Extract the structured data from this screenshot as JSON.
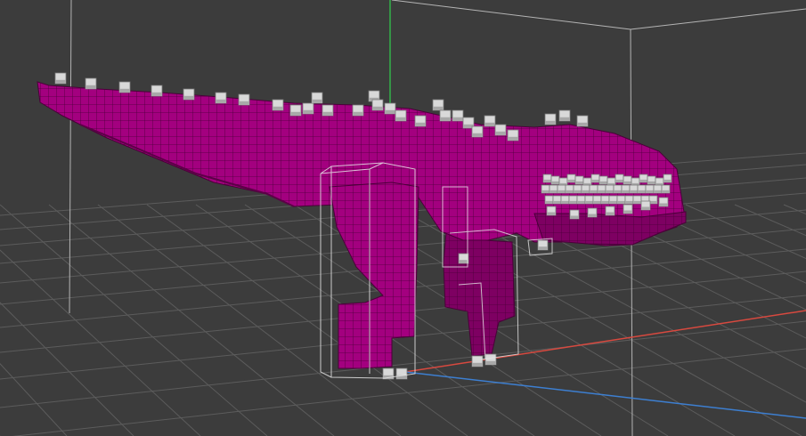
{
  "viewport": {
    "background": "#3c3c3c",
    "grid_color": "#5c5c5c",
    "bounds_color": "#b4b4b4",
    "axis_colors": {
      "x": "#d8493f",
      "y": "#33b24a",
      "z": "#3d7fd1"
    }
  },
  "model": {
    "kind": "voxel-dinosaur",
    "body_color": "#a3007f",
    "body_shade_color": "#7e0062",
    "outline_color": "#4a0039",
    "accent_color": "#d9d9d9",
    "accent_shade_color": "#a8a8a8"
  },
  "selection": {
    "objects": [
      "front-leg-bounding-box",
      "rear-leg-bounding-box"
    ]
  }
}
